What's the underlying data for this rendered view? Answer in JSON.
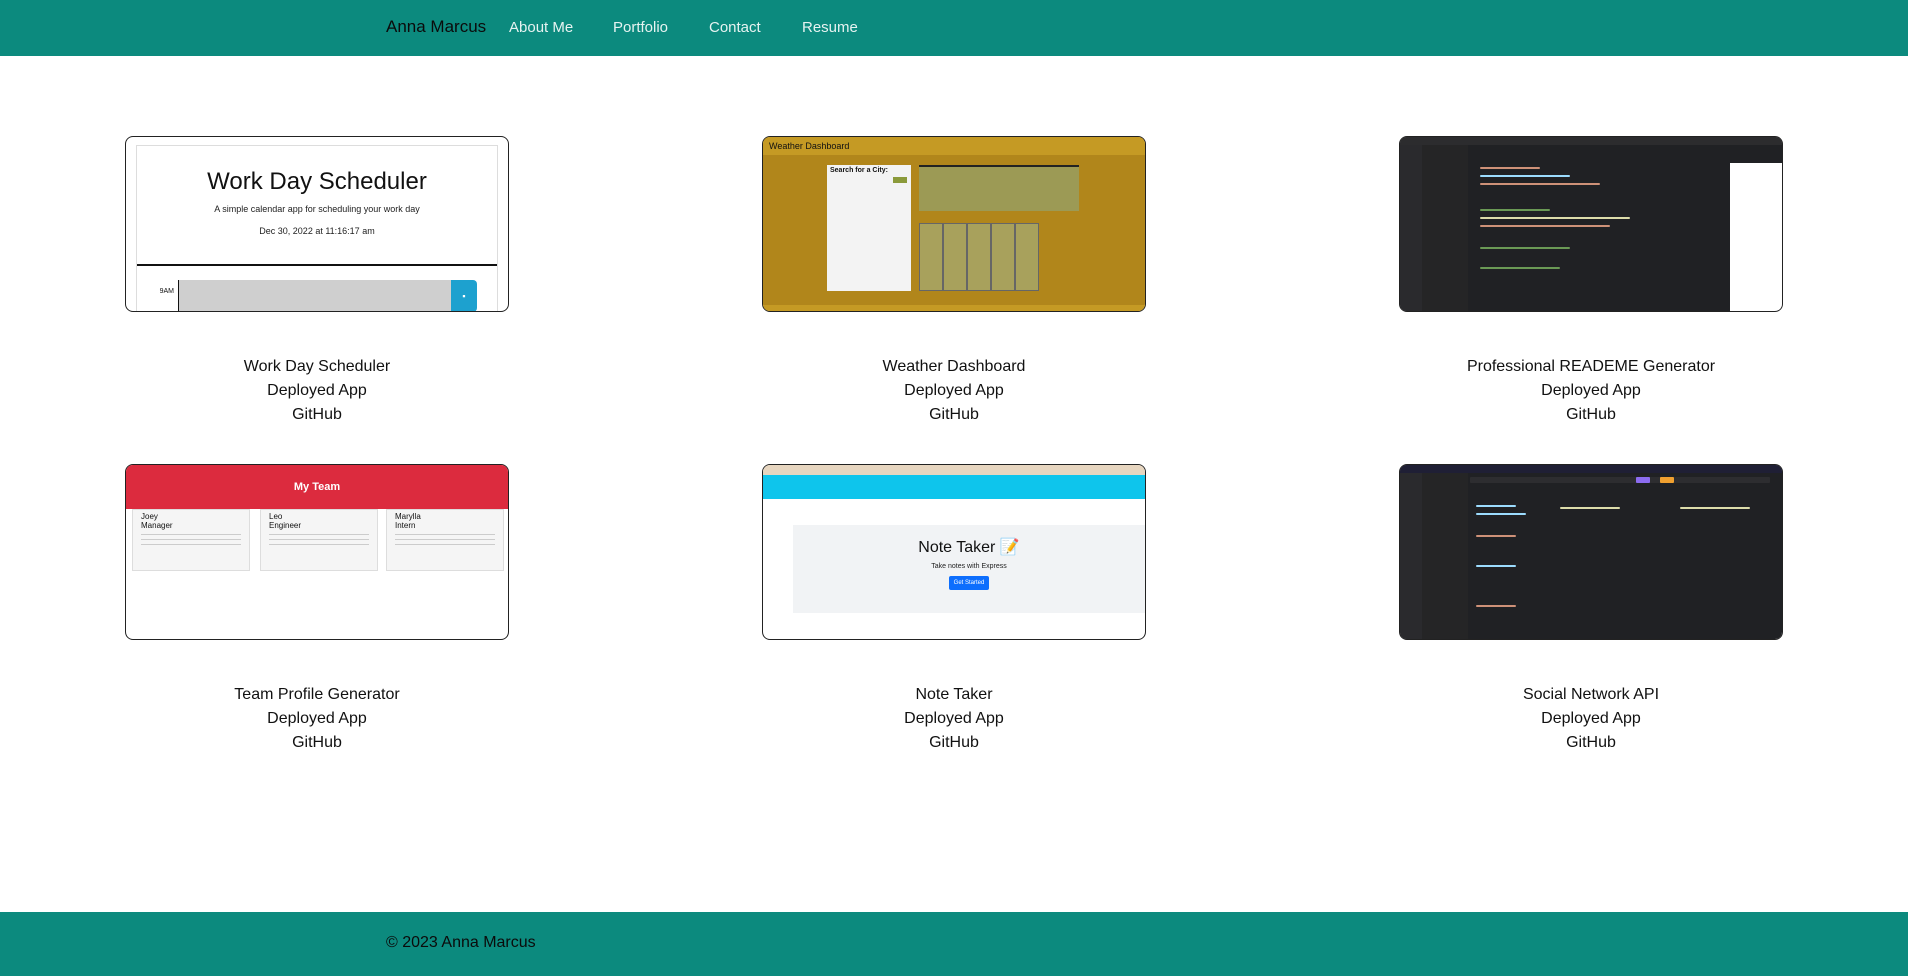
{
  "nav": {
    "brand": "Anna Marcus",
    "links": [
      "About Me",
      "Portfolio",
      "Contact",
      "Resume"
    ]
  },
  "projects": [
    {
      "title": "Work Day Scheduler",
      "deployed": "Deployed App",
      "github": "GitHub",
      "thumb": {
        "heading": "Work Day Scheduler",
        "subtitle": "A simple calendar app for scheduling your work day",
        "date": "Dec 30, 2022 at 11:16:17 am",
        "hour": "9AM"
      }
    },
    {
      "title": "Weather Dashboard",
      "deployed": "Deployed App",
      "github": "GitHub",
      "thumb": {
        "header": "Weather Dashboard",
        "search": "Search for a City:"
      }
    },
    {
      "title": "Professional READEME Generator",
      "deployed": "Deployed App",
      "github": "GitHub"
    },
    {
      "title": "Team Profile Generator",
      "deployed": "Deployed App",
      "github": "GitHub",
      "thumb": {
        "header": "My Team",
        "members": [
          {
            "name": "Joey",
            "role": "Manager"
          },
          {
            "name": "Leo",
            "role": "Engineer"
          },
          {
            "name": "Marylla",
            "role": "Intern"
          }
        ]
      }
    },
    {
      "title": "Note Taker",
      "deployed": "Deployed App",
      "github": "GitHub",
      "thumb": {
        "heading": "Note Taker 📝",
        "subtitle": "Take notes with Express",
        "button": "Get Started"
      }
    },
    {
      "title": "Social Network API",
      "deployed": "Deployed App",
      "github": "GitHub"
    }
  ],
  "footer": {
    "copyright": "© 2023 Anna Marcus"
  },
  "colors": {
    "navbar": "#0c8a7e",
    "footer": "#0c8a7e"
  }
}
